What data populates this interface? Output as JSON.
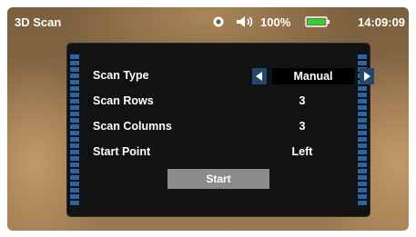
{
  "header": {
    "title": "3D Scan",
    "battery_text": "100%",
    "clock": "14:09:09",
    "icons": [
      "camera-icon",
      "speaker-icon",
      "battery-icon"
    ],
    "battery_color": "#2fd12f"
  },
  "panel": {
    "rows": [
      {
        "label": "Scan Type",
        "value": "Manual"
      },
      {
        "label": "Scan Rows",
        "value": "3"
      },
      {
        "label": "Scan Columns",
        "value": "3"
      },
      {
        "label": "Start Point",
        "value": "Left"
      }
    ],
    "start_label": "Start",
    "accent_color": "#2f76c0"
  }
}
